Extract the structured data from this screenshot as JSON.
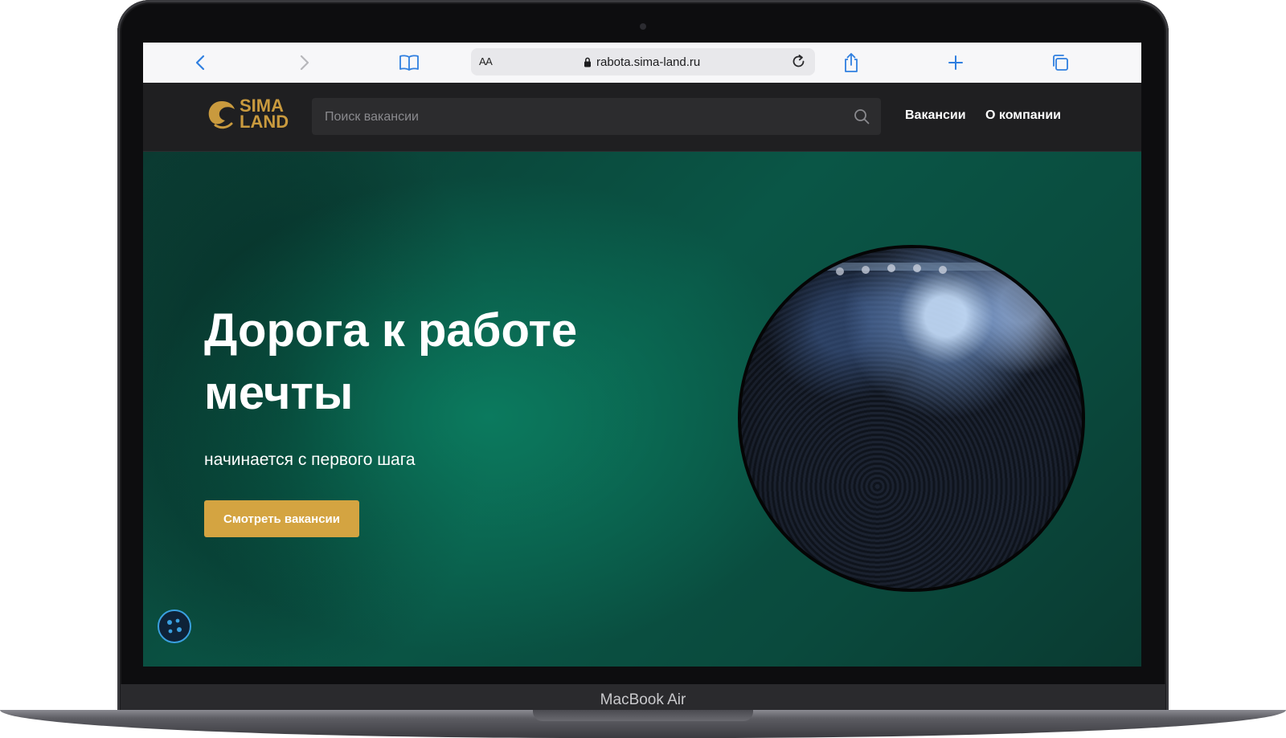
{
  "device": {
    "label": "MacBook Air"
  },
  "browser": {
    "text_size_label": "AA",
    "url": "rabota.sima-land.ru",
    "icons": [
      "back-icon",
      "forward-icon",
      "bookmarks-icon",
      "lock-icon",
      "reload-icon",
      "share-icon",
      "new-tab-icon",
      "tabs-icon"
    ]
  },
  "header": {
    "logo_line1": "SIMA",
    "logo_line2": "LAND",
    "search_placeholder": "Поиск вакансии",
    "nav": [
      "Вакансии",
      "О компании"
    ]
  },
  "hero": {
    "title_line1": "Дорога к работе",
    "title_line2": "мечты",
    "subtitle": "начинается с первого шага",
    "cta_label": "Смотреть вакансии"
  },
  "colors": {
    "accent_gold": "#d4a441",
    "logo_gold": "#c99a3e",
    "hero_green": "#0a5646",
    "header_bg": "#1f1f21",
    "browser_blue": "#2f7fe0"
  }
}
